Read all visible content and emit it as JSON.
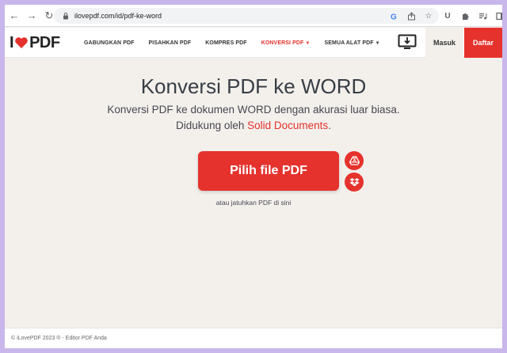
{
  "browser": {
    "url": "ilovepdf.com/id/pdf-ke-word"
  },
  "header": {
    "logo_left": "I",
    "logo_right": "PDF",
    "nav": [
      {
        "label": "GABUNGKAN PDF"
      },
      {
        "label": "PISAHKAN PDF"
      },
      {
        "label": "KOMPRES PDF"
      },
      {
        "label": "KONVERSI PDF"
      },
      {
        "label": "SEMUA ALAT PDF"
      }
    ],
    "login": "Masuk",
    "signup": "Daftar"
  },
  "main": {
    "title": "Konversi PDF ke WORD",
    "subtitle_line1": "Konversi PDF ke dokumen WORD dengan akurasi luar biasa.",
    "subtitle_line2_prefix": "Didukung oleh ",
    "subtitle_link": "Solid Documents",
    "subtitle_line2_suffix": ".",
    "pick_button": "Pilih file PDF",
    "drop_hint": "atau jatuhkan PDF di sini"
  },
  "footer": {
    "text": "© iLovePDF 2023 ® - Editor PDF Anda"
  },
  "colors": {
    "accent": "#e5322d",
    "page_bg": "#f3f0ec",
    "text": "#383e45"
  }
}
